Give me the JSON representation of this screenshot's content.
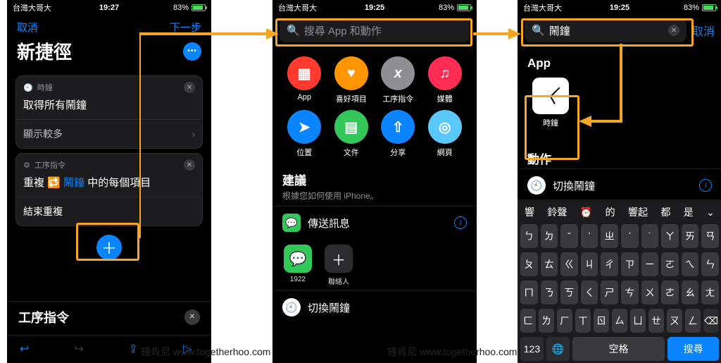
{
  "status": {
    "carrier": "台灣大哥大",
    "battery_pct": "83%"
  },
  "p1": {
    "time": "19:27",
    "cancel": "取消",
    "next": "下一步",
    "title": "新捷徑",
    "card1_app": "時鐘",
    "card1_action": "取得所有鬧鐘",
    "card1_more": "顯示較多",
    "card2_app": "工序指令",
    "card2_line_a": "重複",
    "card2_link": "鬧鐘",
    "card2_line_b": "中的每個項目",
    "card2_end": "結束重複",
    "bottom_label": "工序指令"
  },
  "p2": {
    "time": "19:25",
    "search_placeholder": "搜尋 App 和動作",
    "grid": {
      "app": "App",
      "fav": "喜好項目",
      "script": "工序指令",
      "media": "媒體",
      "loc": "位置",
      "doc": "文件",
      "share": "分享",
      "web": "網頁"
    },
    "suggest_h": "建議",
    "suggest_sub": "根據您如何使用 iPhone。",
    "row1": "傳送訊息",
    "mini1": "1922",
    "mini2": "聯絡人",
    "row2": "切換鬧鐘"
  },
  "p3": {
    "time": "19:25",
    "search_value": "鬧鐘",
    "cancel": "取消",
    "app_h": "App",
    "clock_label": "時鐘",
    "actions_h": "動作",
    "action_row": "切換鬧鐘",
    "candidates": [
      "響",
      "鈴聲",
      "⏰",
      "的",
      "響起",
      "都",
      "是"
    ],
    "space": "空格",
    "search_btn": "搜尋",
    "kbd_rows": [
      [
        "ㄅ",
        "ㄉ",
        "ˇ",
        "ˋ",
        "ㄓ",
        "ˊ",
        "˙",
        "ㄚ",
        "ㄞ",
        "ㄢ"
      ],
      [
        "ㄆ",
        "ㄊ",
        "ㄍ",
        "ㄐ",
        "ㄔ",
        "ㄗ",
        "ㄧ",
        "ㄛ",
        "ㄟ",
        "ㄣ"
      ],
      [
        "ㄇ",
        "ㄋ",
        "ㄎ",
        "ㄑ",
        "ㄕ",
        "ㄘ",
        "ㄨ",
        "ㄜ",
        "ㄠ",
        "ㄤ"
      ],
      [
        "ㄈ",
        "ㄌ",
        "ㄏ",
        "ㄒ",
        "ㄖ",
        "ㄙ",
        "ㄩ",
        "ㄝ",
        "ㄡ",
        "ㄥ"
      ]
    ]
  },
  "watermark": "鍾肯尼   www.togetherhoo.com"
}
